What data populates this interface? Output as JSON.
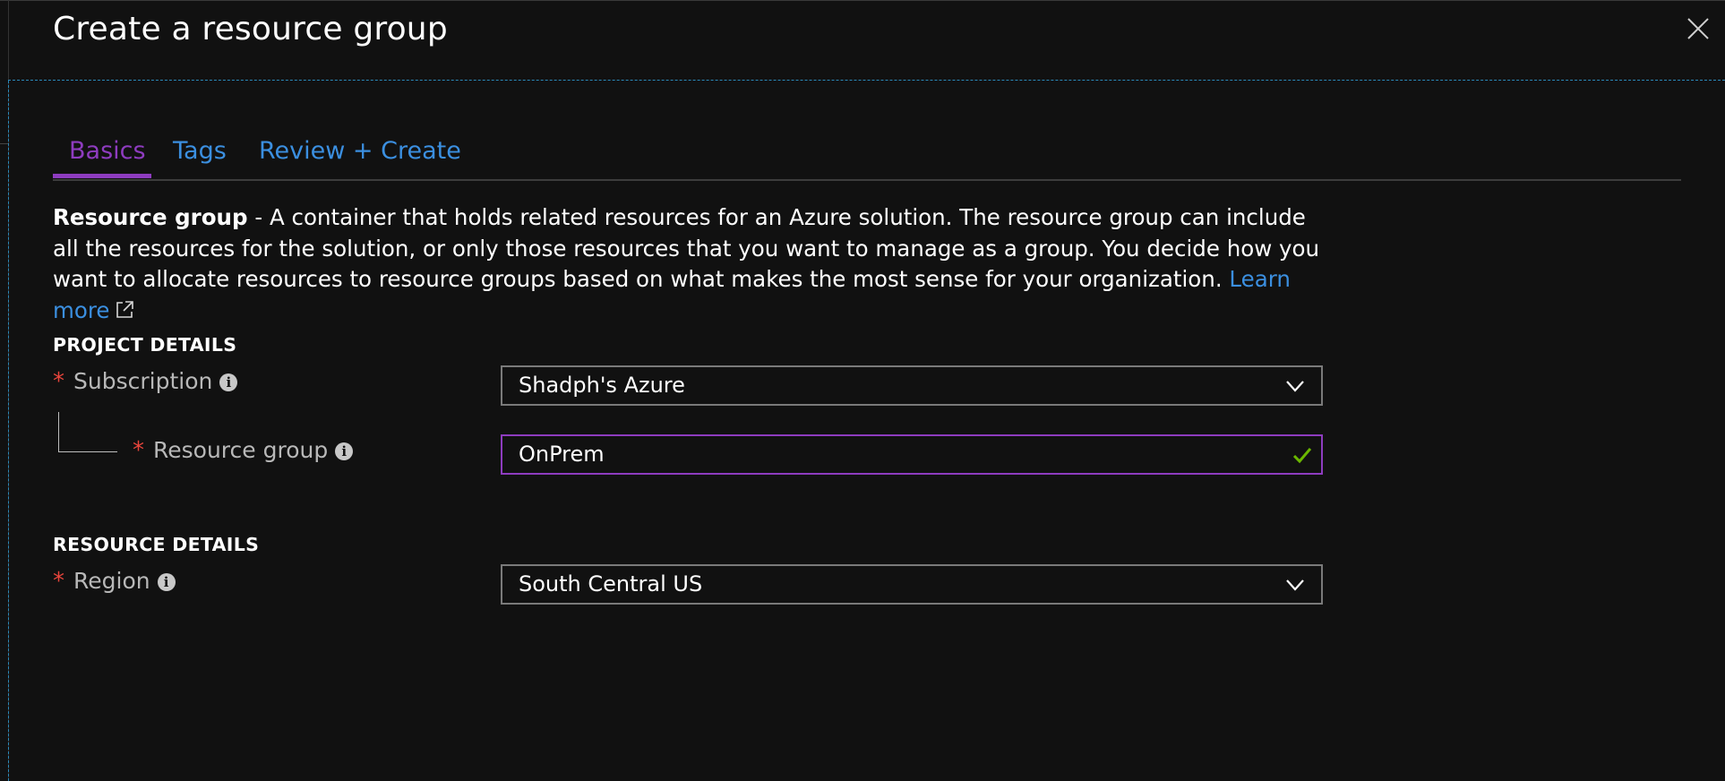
{
  "blade": {
    "title": "Create a resource group",
    "close_icon": "close-icon"
  },
  "tabs": [
    {
      "label": "Basics",
      "active": true
    },
    {
      "label": "Tags",
      "active": false
    },
    {
      "label": "Review + Create",
      "active": false
    }
  ],
  "description": {
    "bold_lead": "Resource group",
    "text": " - A container that holds related resources for an Azure solution. The resource group can include all the resources for the solution, or only those resources that you want to manage as a group. You decide how you want to allocate resources to resource groups based on what makes the most sense for your organization. ",
    "link_label": "Learn more",
    "link_icon": "external-link-icon"
  },
  "project_details": {
    "header": "PROJECT DETAILS",
    "subscription": {
      "label": "Subscription",
      "required_mark": "*",
      "value": "Shadph's Azure",
      "info_icon": "info-icon"
    },
    "resource_group": {
      "label": "Resource group",
      "required_mark": "*",
      "value": "OnPrem",
      "valid": true,
      "info_icon": "info-icon"
    }
  },
  "resource_details": {
    "header": "RESOURCE DETAILS",
    "region": {
      "label": "Region",
      "required_mark": "*",
      "value": "South Central US",
      "info_icon": "info-icon"
    }
  },
  "colors": {
    "background": "#111111",
    "accent_purple": "#8e3cbf",
    "link_blue": "#3b8fe0",
    "required_red": "#e8453c",
    "valid_green": "#6bb700"
  }
}
